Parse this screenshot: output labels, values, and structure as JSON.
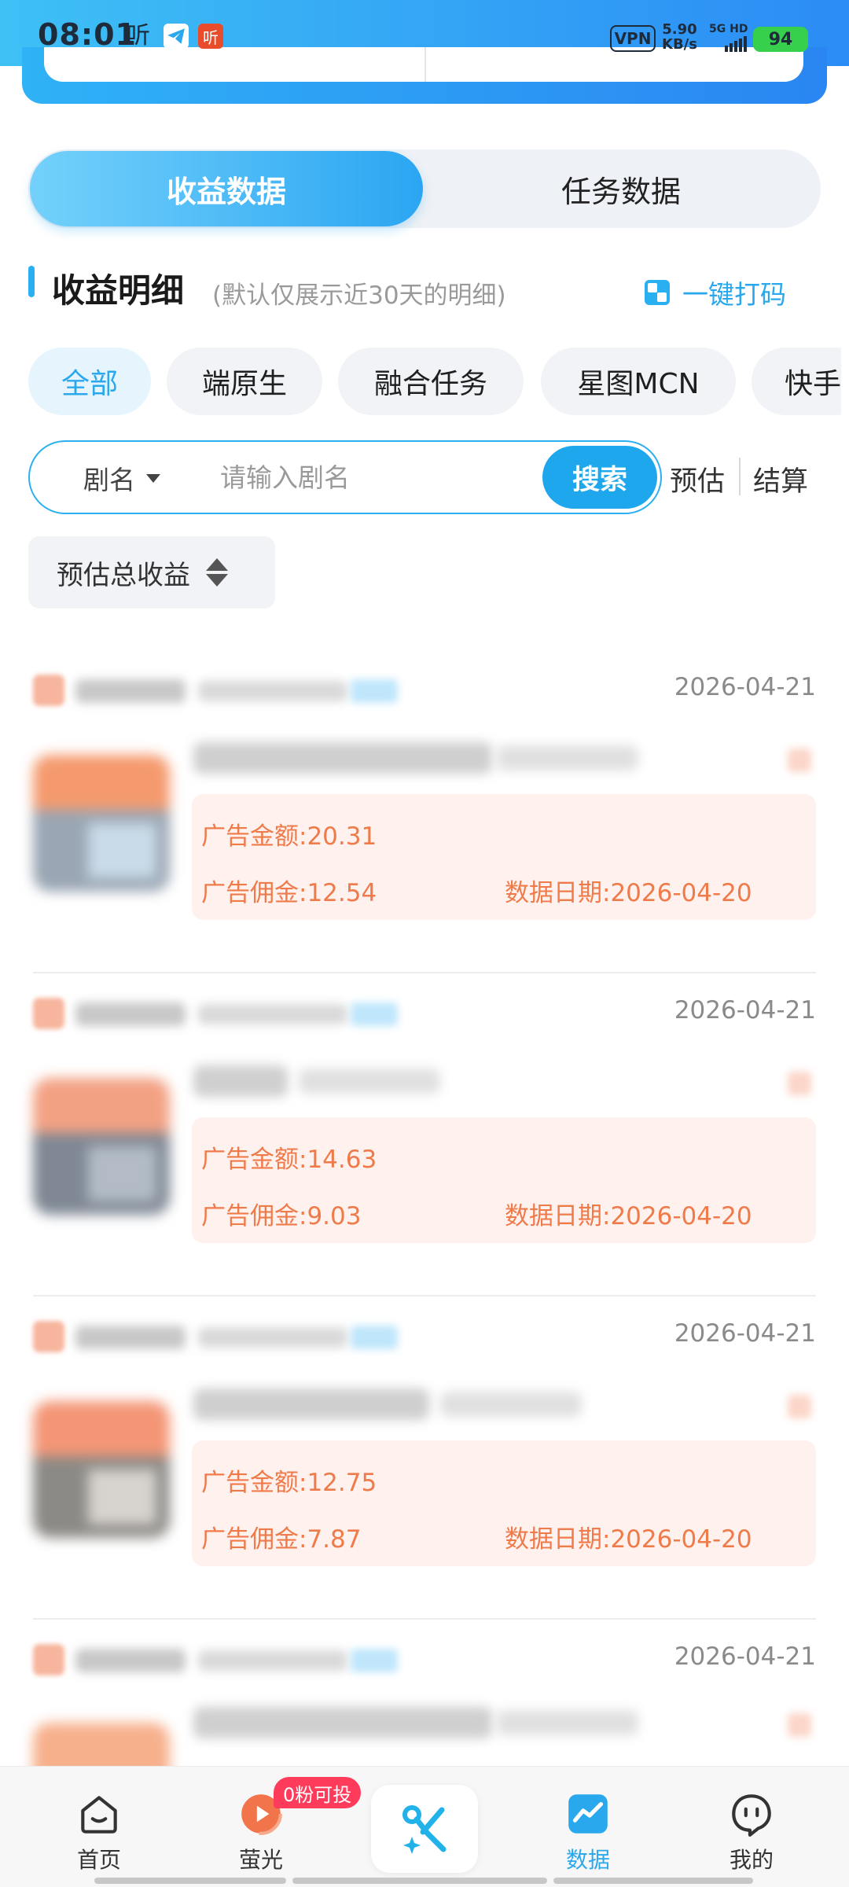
{
  "status_bar": {
    "time": "08:01",
    "ting_label": "听",
    "red_app_label": "听",
    "vpn": "VPN",
    "speed_value": "5.90",
    "speed_unit": "KB/s",
    "network": "5G HD",
    "battery": "94"
  },
  "tabs": {
    "earnings": "收益数据",
    "tasks": "任务数据"
  },
  "section": {
    "title": "收益明细",
    "subtitle": "(默认仅展示近30天的明细)",
    "quick_code": "一键打码"
  },
  "filters": [
    "全部",
    "端原生",
    "融合任务",
    "星图MCN",
    "快手"
  ],
  "search": {
    "type": "剧名",
    "placeholder": "请输入剧名",
    "button": "搜索",
    "toggle_estimate": "预估",
    "toggle_settle": "结算"
  },
  "sort": {
    "label": "预估总收益"
  },
  "records": [
    {
      "date": "2026-04-21",
      "ad_amount_label": "广告金额:20.31",
      "ad_commission_label": "广告佣金:12.54",
      "data_date_label": "数据日期:2026-04-20"
    },
    {
      "date": "2026-04-21",
      "ad_amount_label": "广告金额:14.63",
      "ad_commission_label": "广告佣金:9.03",
      "data_date_label": "数据日期:2026-04-20"
    },
    {
      "date": "2026-04-21",
      "ad_amount_label": "广告金额:12.75",
      "ad_commission_label": "广告佣金:7.87",
      "data_date_label": "数据日期:2026-04-20"
    },
    {
      "date": "2026-04-21",
      "ad_amount_label": "",
      "ad_commission_label": "",
      "data_date_label": ""
    }
  ],
  "bottom_nav": {
    "home": "首页",
    "firefly": "萤光",
    "firefly_badge": "0粉可投",
    "data": "数据",
    "mine": "我的"
  },
  "colors": {
    "accent": "#2aa8ee",
    "orange_text": "#ef7a4a",
    "panel_bg": "#fff2ee",
    "badge": "#ff3b5c"
  }
}
